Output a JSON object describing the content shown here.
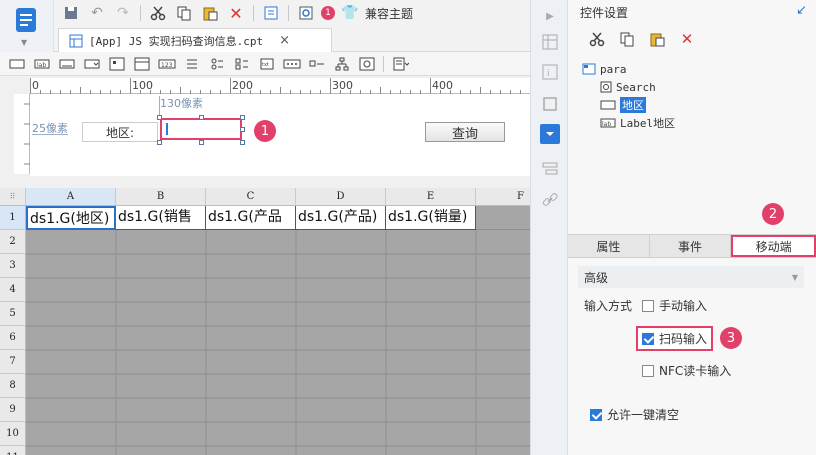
{
  "toolbar": {
    "notification_count": "1",
    "theme_label": "兼容主题"
  },
  "tab": {
    "title": "[App] JS 实现扫码查询信息.cpt",
    "close": "×"
  },
  "ruler": {
    "ticks": [
      "0",
      "100",
      "200",
      "300",
      "400"
    ],
    "width_hint": "130像素",
    "height_hint": "25像素"
  },
  "form": {
    "label": "地区:",
    "input_value": "",
    "query_button": "查询"
  },
  "sheet": {
    "columns": [
      "A",
      "B",
      "C",
      "D",
      "E",
      "F"
    ],
    "rows": [
      "1",
      "2",
      "3",
      "4",
      "5",
      "6",
      "7",
      "8",
      "9",
      "10",
      "11"
    ],
    "row1": [
      "ds1.G(地区)",
      "ds1.G(销售",
      "ds1.G(产品",
      "ds1.G(产品)",
      "ds1.G(销量)"
    ]
  },
  "panel": {
    "title": "控件设置",
    "tree": {
      "root": "para",
      "children": [
        "Search",
        "地区",
        "Label地区"
      ]
    },
    "tabs": [
      "属性",
      "事件",
      "移动端"
    ],
    "active_tab": 2,
    "advanced": "高级",
    "input_method_label": "输入方式",
    "options": {
      "manual": "手动输入",
      "scan": "扫码输入",
      "nfc": "NFC读卡输入",
      "clear": "允许一键清空"
    }
  },
  "callouts": [
    "1",
    "2",
    "3"
  ],
  "colors": {
    "accent": "#e0406a",
    "brand_blue": "#2b79d8"
  }
}
